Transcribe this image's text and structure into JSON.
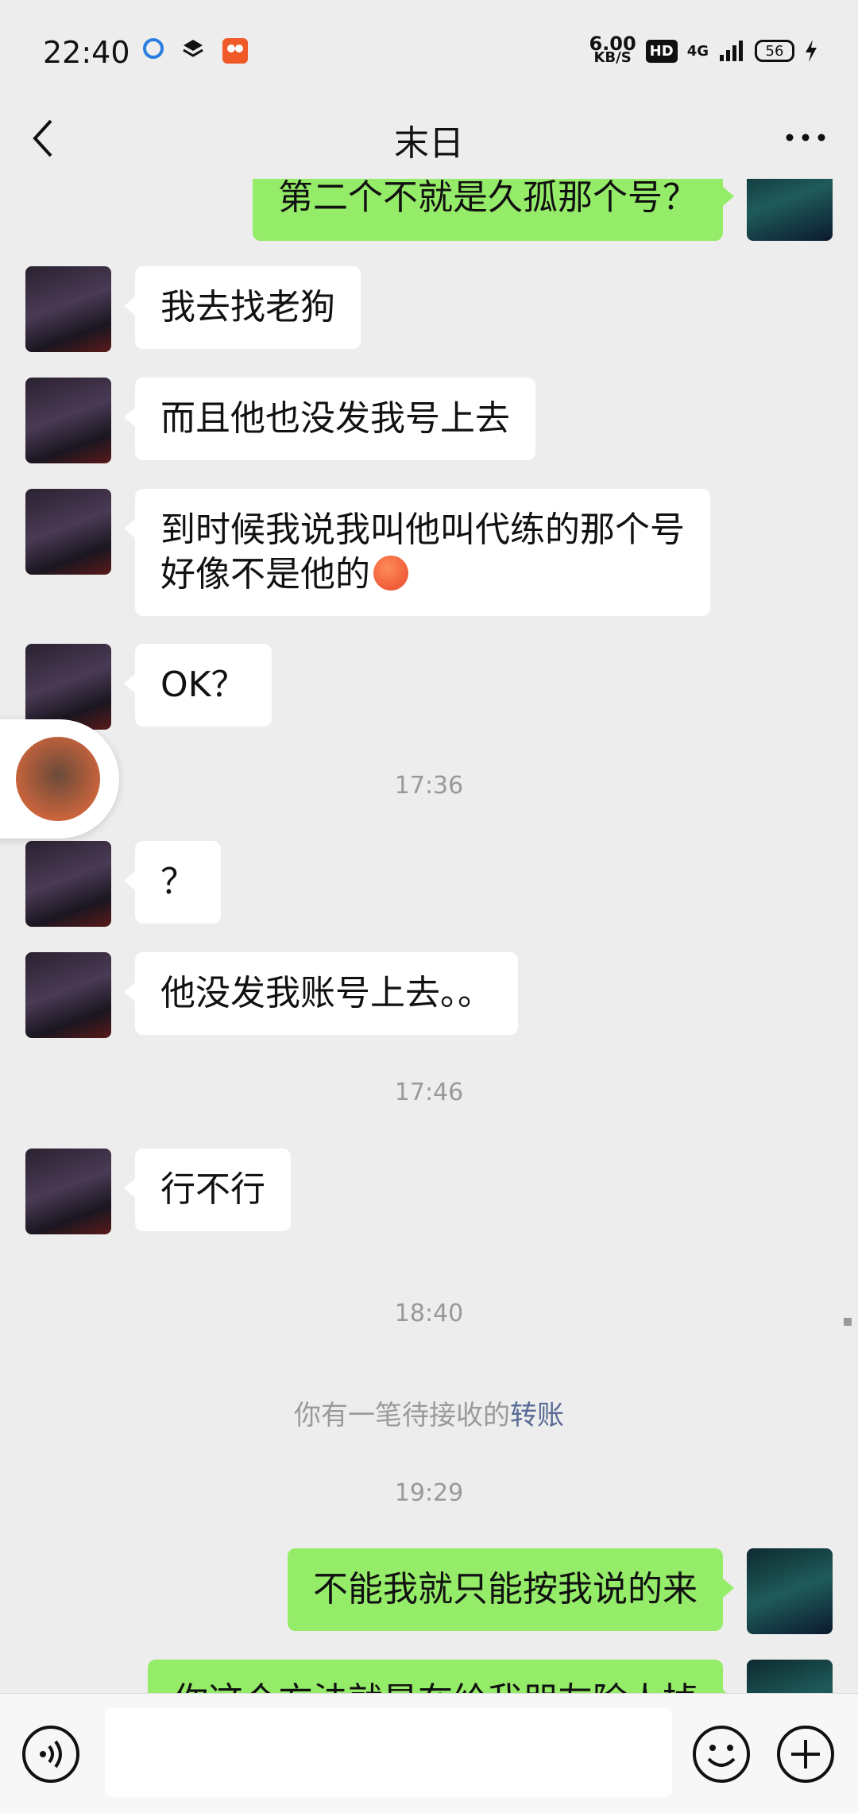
{
  "status_bar": {
    "time": "22:40",
    "net_speed_value": "6.00",
    "net_speed_unit": "KB/S",
    "hd_label": "HD",
    "network_label": "4G",
    "battery_level": "56"
  },
  "header": {
    "title": "末日"
  },
  "messages": [
    {
      "side": "right",
      "text": "第二个不就是久孤那个号？"
    },
    {
      "side": "left",
      "text": "我去找老狗"
    },
    {
      "side": "left",
      "text": "而且他也没发我号上去"
    },
    {
      "side": "left",
      "line1": "到时候我说我叫他叫代练的那个号",
      "line2": "好像不是他的"
    },
    {
      "side": "left",
      "text": "OK？"
    },
    {
      "side": "left",
      "text": "？"
    },
    {
      "side": "left",
      "text": "他没发我账号上去。。"
    },
    {
      "side": "left",
      "text": "行不行"
    },
    {
      "side": "right",
      "text": "不能我就只能按我说的来"
    },
    {
      "side": "right",
      "text": "你这个方法就是在给我朋友除人掉"
    }
  ],
  "timestamps": [
    "17:36",
    "17:46",
    "18:40",
    "19:29"
  ],
  "system_message": {
    "text": "你有一笔待接收的",
    "link": "转账"
  },
  "icons": {
    "back": "chevron-left-icon",
    "more": "more-dots-icon",
    "voice": "voice-icon",
    "emoji": "emoji-icon",
    "plus": "plus-icon"
  },
  "colors": {
    "background": "#ededed",
    "sent_bubble": "#95ec69",
    "received_bubble": "#ffffff",
    "link": "#576b95"
  }
}
